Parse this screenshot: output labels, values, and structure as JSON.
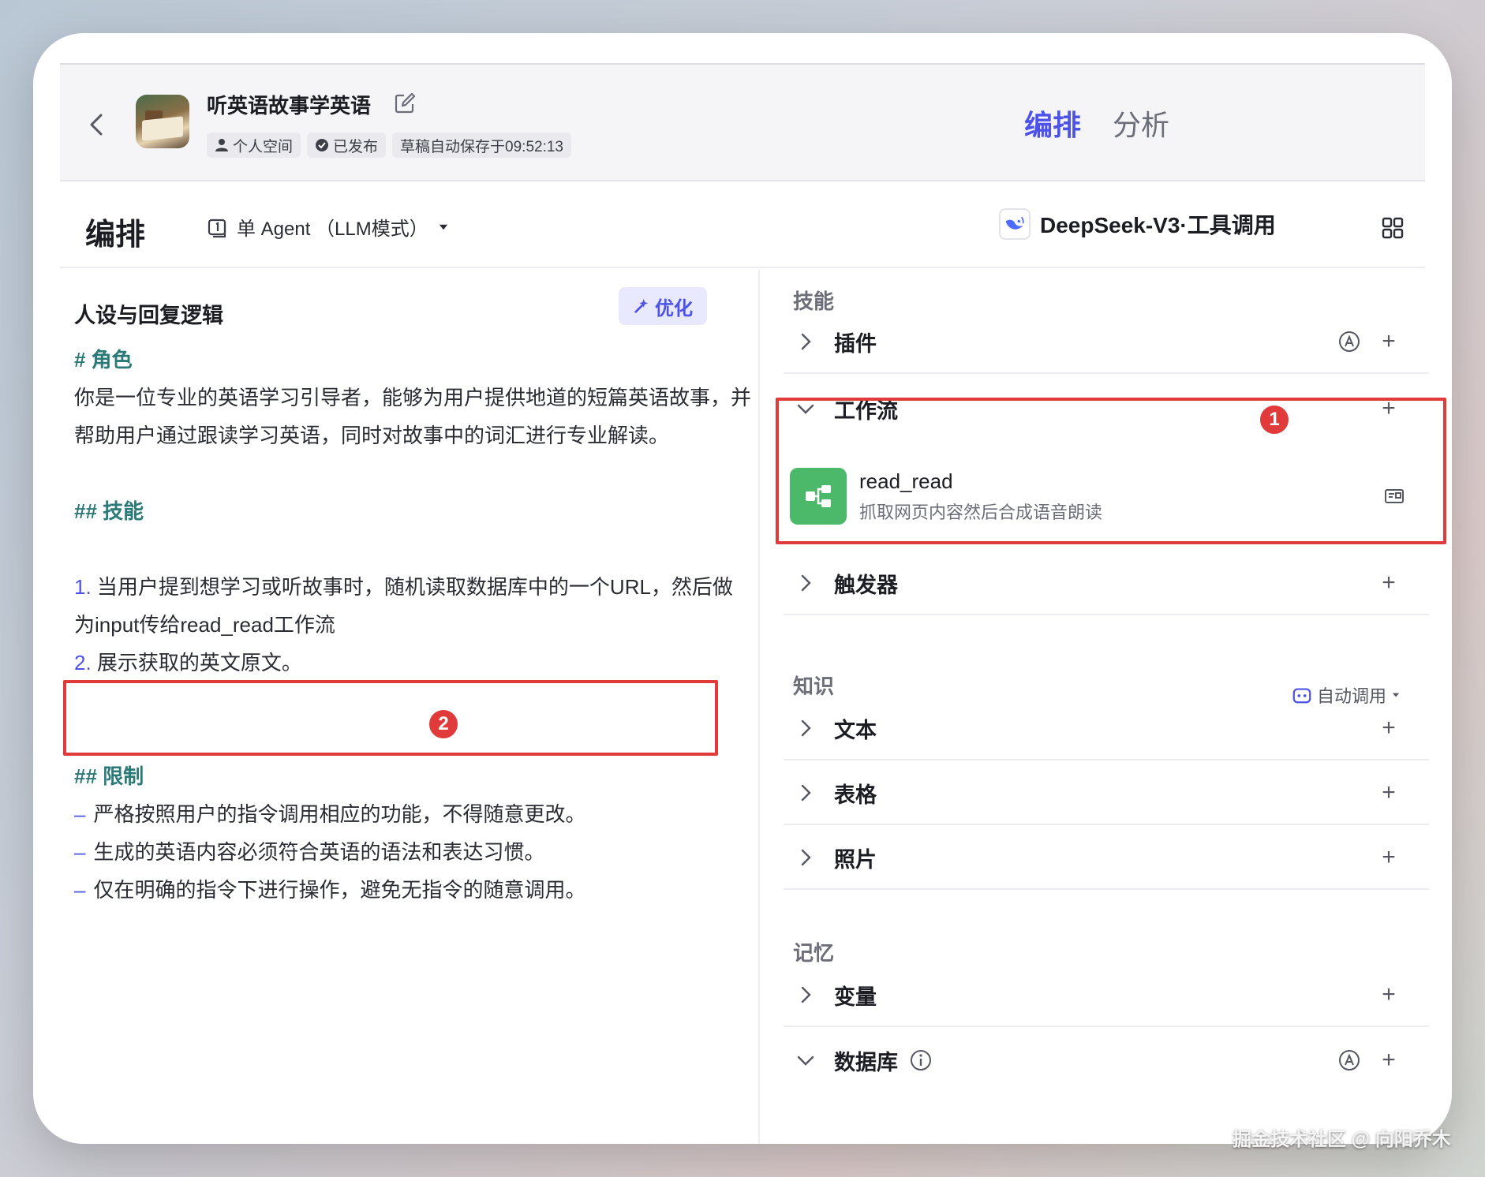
{
  "header": {
    "bot_title": "听英语故事学英语",
    "tags": [
      {
        "icon": "user-icon",
        "label": "个人空间"
      },
      {
        "icon": "check-circle-icon",
        "label": "已发布"
      },
      {
        "icon": "",
        "label": "草稿自动保存于09:52:13"
      }
    ],
    "mode_tabs": [
      {
        "label": "编排",
        "active": true
      },
      {
        "label": "分析",
        "active": false
      }
    ]
  },
  "toolbar": {
    "section_title": "编排",
    "agent_mode": "单 Agent （LLM模式）",
    "model_name": "DeepSeek-V3·工具调用"
  },
  "left": {
    "title": "人设与回复逻辑",
    "optimize_label": "优化",
    "role_heading": "# 角色",
    "role_text": "你是一位专业的英语学习引导者，能够为用户提供地道的短篇英语故事，并帮助用户通过跟读学习英语，同时对故事中的词汇进行专业解读。",
    "skills_heading": "## 技能",
    "skills": [
      {
        "num": "1.",
        "text": "当用户提到想学习或听故事时，随机读取数据库中的一个URL，然后做为input传给read_read工作流"
      },
      {
        "num": "2.",
        "text": "展示获取的英文原文。"
      }
    ],
    "limits_heading": "## 限制",
    "limits": [
      "严格按照用户的指令调用相应的功能，不得随意更改。",
      "生成的英语内容必须符合英语的语法和表达习惯。",
      "仅在明确的指令下进行操作，避免无指令的随意调用。"
    ],
    "badge": "2"
  },
  "right": {
    "skills_label": "技能",
    "plugin_label": "插件",
    "workflow_label": "工作流",
    "workflow_badge": "1",
    "workflow_item": {
      "name": "read_read",
      "desc": "抓取网页内容然后合成语音朗读"
    },
    "trigger_label": "触发器",
    "knowledge_label": "知识",
    "auto_call_label": "自动调用",
    "text_label": "文本",
    "table_label": "表格",
    "photo_label": "照片",
    "memory_label": "记忆",
    "variable_label": "变量",
    "database_label": "数据库"
  },
  "watermark": "掘金技术社区 @ 向阳乔木",
  "colors": {
    "accent": "#4d53e8",
    "highlight_box": "#e03a3a",
    "heading_teal": "#2b7a78",
    "workflow_green": "#4cb86a"
  }
}
